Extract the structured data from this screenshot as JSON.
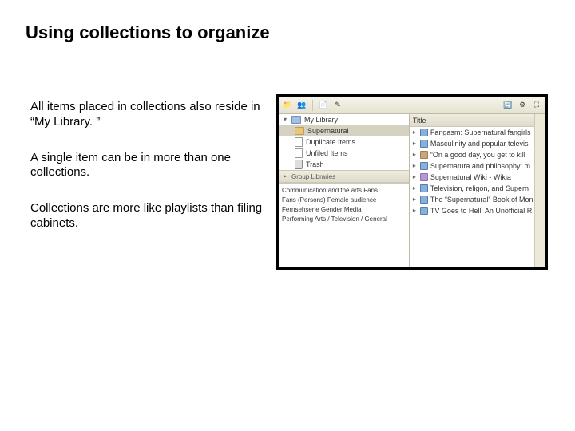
{
  "title": "Using collections to organize",
  "paragraphs": [
    "All items placed in collections also reside in “My Library. ”",
    "A single item can be in more than one collections.",
    "Collections are more like playlists than filing cabinets."
  ],
  "screenshot": {
    "library": {
      "root": "My Library",
      "children": [
        "Supernatural",
        "Duplicate Items",
        "Unfiled Items",
        "Trash"
      ]
    },
    "group_header": "Group Libraries",
    "tags_line1": "Communication and the arts   Fans",
    "tags_line2": "Fans (Persons)   Female audience",
    "tags_line3": "Fernsehserie   Gender   Media",
    "tags_line4": "Performing Arts / Television / General",
    "column_header": "Title",
    "items": [
      "Fangasm: Supernatural fangirls",
      "Masculinity and popular televisi",
      "“On a good day, you get to kill",
      "Supernatura and philosophy: m",
      "Supernatural Wiki - Wikia",
      "Television, religon, and Supern",
      "The “Supernatural” Book of Mon",
      "TV Goes to Hell: An Unofficial R"
    ]
  }
}
